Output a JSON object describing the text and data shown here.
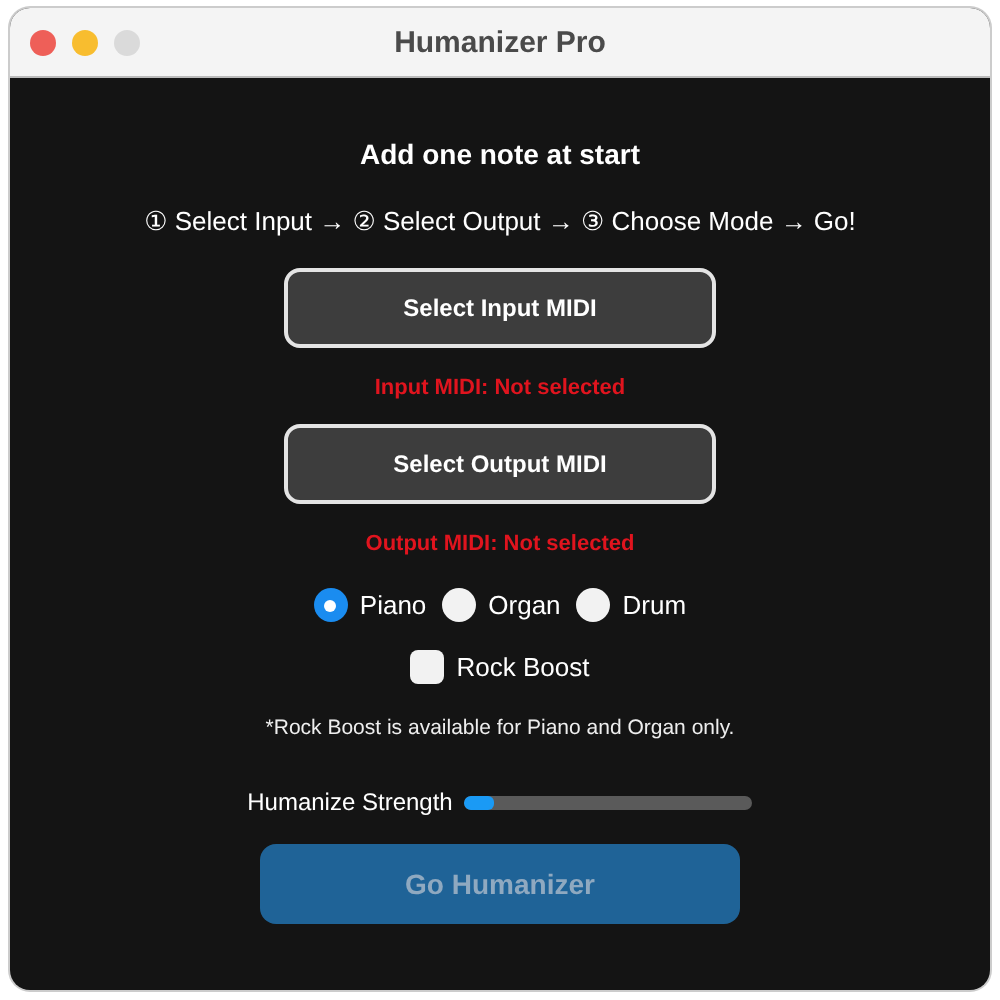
{
  "window": {
    "title": "Humanizer Pro"
  },
  "heading": "Add one note at start",
  "steps": "① Select Input → ② Select Output → ③ Choose Mode → Go!",
  "input_button": "Select Input MIDI",
  "input_status": "Input MIDI: Not selected",
  "output_button": "Select Output MIDI",
  "output_status": "Output MIDI: Not selected",
  "modes": [
    {
      "label": "Piano",
      "selected": true
    },
    {
      "label": "Organ",
      "selected": false
    },
    {
      "label": "Drum",
      "selected": false
    }
  ],
  "rock_boost": {
    "label": "Rock Boost",
    "checked": false
  },
  "note": "*Rock Boost is available for Piano and Organ only.",
  "strength": {
    "label": "Humanize Strength",
    "level": 0.1
  },
  "go_button": {
    "label": "Go Humanizer",
    "disabled": true
  }
}
